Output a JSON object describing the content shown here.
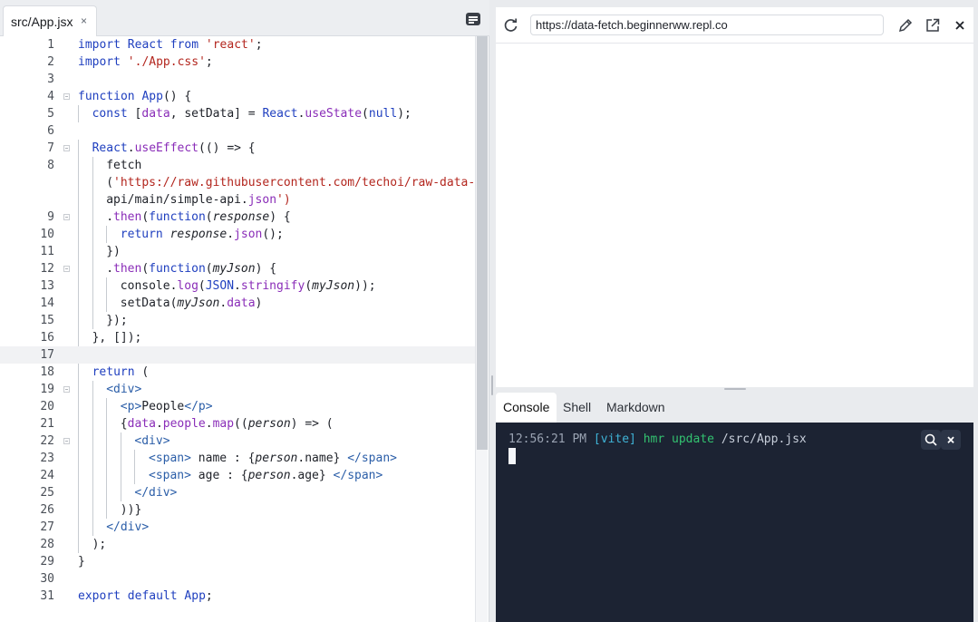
{
  "editor": {
    "tab_label": "src/App.jsx",
    "tab_close": "×"
  },
  "browser": {
    "url": "https://data-fetch.beginnerww.repl.co"
  },
  "console": {
    "tabs": [
      "Console",
      "Shell",
      "Markdown"
    ],
    "active_tab": "Console",
    "log": {
      "time": "12:56:21 PM",
      "tag": "[vite]",
      "msg": "hmr update",
      "path": "/src/App.jsx"
    },
    "close_label": "×"
  },
  "code_lines": [
    {
      "n": "1",
      "src": "import React from 'react';"
    },
    {
      "n": "2",
      "src": "import './App.css';"
    },
    {
      "n": "3",
      "src": ""
    },
    {
      "n": "4",
      "src": "function App() {"
    },
    {
      "n": "5",
      "src": "const [data, setData] = React.useState(null);"
    },
    {
      "n": "6",
      "src": ""
    },
    {
      "n": "7",
      "src": "React.useEffect(() => {"
    },
    {
      "n": "8",
      "src": "fetch"
    },
    {
      "n": "",
      "src": "('https://raw.githubusercontent.com/techoi/raw-data-"
    },
    {
      "n": "",
      "src": "api/main/simple-api.json')"
    },
    {
      "n": "9",
      "src": ".then(function(response) {"
    },
    {
      "n": "10",
      "src": "return response.json();"
    },
    {
      "n": "11",
      "src": "})"
    },
    {
      "n": "12",
      "src": ".then(function(myJson) {"
    },
    {
      "n": "13",
      "src": "console.log(JSON.stringify(myJson));"
    },
    {
      "n": "14",
      "src": "setData(myJson.data)"
    },
    {
      "n": "15",
      "src": "});"
    },
    {
      "n": "16",
      "src": "}, []);"
    },
    {
      "n": "17",
      "src": ""
    },
    {
      "n": "18",
      "src": "return ("
    },
    {
      "n": "19",
      "src": "<div>"
    },
    {
      "n": "20",
      "src": "<p>People</p>"
    },
    {
      "n": "21",
      "src": "{data.people.map((person) => ("
    },
    {
      "n": "22",
      "src": "<div>"
    },
    {
      "n": "23",
      "src": "<span> name : {person.name} </span>"
    },
    {
      "n": "24",
      "src": "<span> age : {person.age} </span>"
    },
    {
      "n": "25",
      "src": "</div>"
    },
    {
      "n": "26",
      "src": "))}"
    },
    {
      "n": "27",
      "src": "</div>"
    },
    {
      "n": "28",
      "src": ");"
    },
    {
      "n": "29",
      "src": "}"
    },
    {
      "n": "30",
      "src": ""
    },
    {
      "n": "31",
      "src": "export default App;"
    }
  ]
}
